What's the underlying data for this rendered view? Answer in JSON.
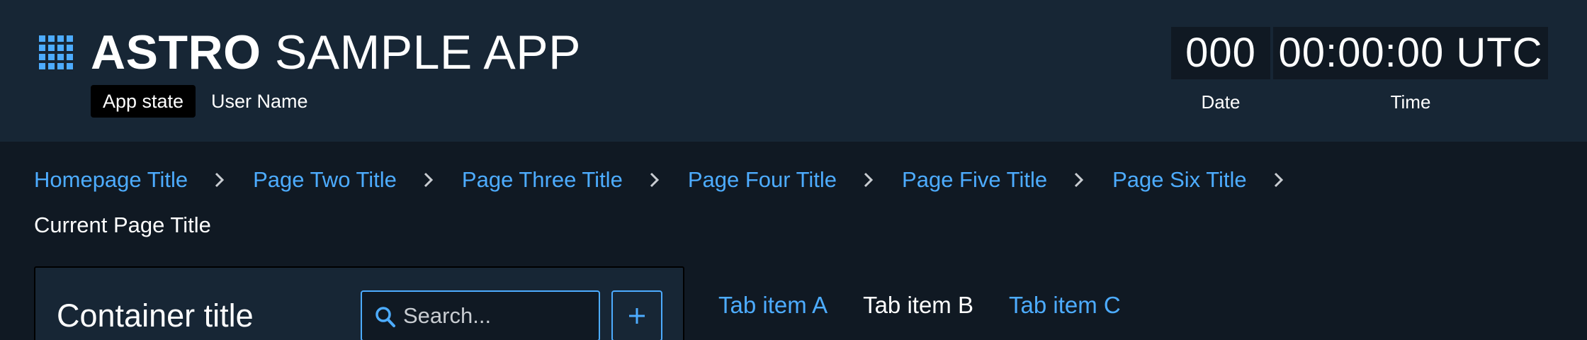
{
  "colors": {
    "accent": "#4dacff",
    "header_background": "#172635",
    "page_background": "#101923",
    "state_badge": "#000000"
  },
  "header": {
    "app_switcher_icon": "grid-icon",
    "title_bold": "ASTRO",
    "title_light": "SAMPLE APP",
    "app_state": "App state",
    "user_name": "User Name",
    "clock": {
      "date_value": "000",
      "time_value": "00:00:00 UTC",
      "date_label": "Date",
      "time_label": "Time"
    }
  },
  "breadcrumbs": {
    "separator_icon": "chevron-right-icon",
    "items": [
      "Homepage Title",
      "Page Two Title",
      "Page Three Title",
      "Page Four Title",
      "Page Five Title",
      "Page Six Title"
    ],
    "current": "Current Page Title"
  },
  "container": {
    "title": "Container title",
    "search_placeholder": "Search...",
    "search_icon": "search-icon",
    "add_icon": "plus-icon"
  },
  "tabs": [
    {
      "label": "Tab item A",
      "selected": false
    },
    {
      "label": "Tab item B",
      "selected": true
    },
    {
      "label": "Tab item C",
      "selected": false
    }
  ]
}
